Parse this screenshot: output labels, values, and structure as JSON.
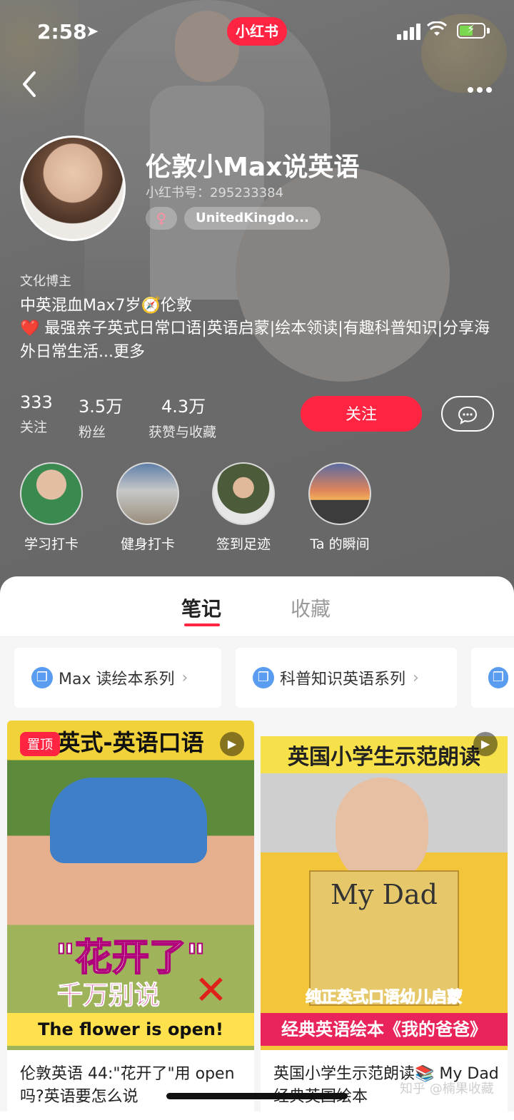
{
  "status_bar": {
    "time": "2:58",
    "brand": "小红书"
  },
  "profile": {
    "nickname": "伦敦小Max说英语",
    "red_id": "小红书号：295233384",
    "gender_symbol": "♀",
    "location": "UnitedKingdo...",
    "role": "文化博主",
    "bio_line1": "中英混血Max7岁🧭伦敦",
    "bio_line2": "❤️ 最强亲子英式日常口语|英语启蒙|绘本领读|有趣科普知识|分享海外日常生活...更多"
  },
  "stats": [
    {
      "value": "333",
      "label": "关注"
    },
    {
      "value": "3.5万",
      "label": "粉丝"
    },
    {
      "value": "4.3万",
      "label": "获赞与收藏"
    }
  ],
  "actions": {
    "follow_label": "关注",
    "chat_icon": "chat-bubble-icon"
  },
  "highlights": [
    {
      "label": "学习打卡"
    },
    {
      "label": "健身打卡"
    },
    {
      "label": "签到足迹"
    },
    {
      "label": "Ta 的瞬间"
    }
  ],
  "tabs": [
    {
      "label": "笔记",
      "active": true
    },
    {
      "label": "收藏",
      "active": false
    }
  ],
  "collections": [
    {
      "label": "Max 读绘本系列"
    },
    {
      "label": "科普知识英语系列"
    }
  ],
  "notes": [
    {
      "badge": "置顶",
      "thumb_top_text": "英式-英语口语",
      "thumb_big_text": "\"花开了\"",
      "thumb_mid_text": "千万别说",
      "thumb_bottom_text": "The flower is open!",
      "title": "伦敦英语 44:\"花开了\"用 open吗?英语要怎么说"
    },
    {
      "thumb_top_text": "英国小学生示范朗读",
      "thumb_book_title": "My Dad",
      "thumb_caption1": "纯正英式口语幼儿启蒙",
      "thumb_caption2": "经典英语绘本《我的爸爸》",
      "title": "英国小学生示范朗读📚 My Dad经典英国绘本"
    }
  ],
  "watermark": "知乎 @楠果收藏",
  "colors": {
    "accent": "#ff2442",
    "collection_icon": "#5a9cf0"
  }
}
